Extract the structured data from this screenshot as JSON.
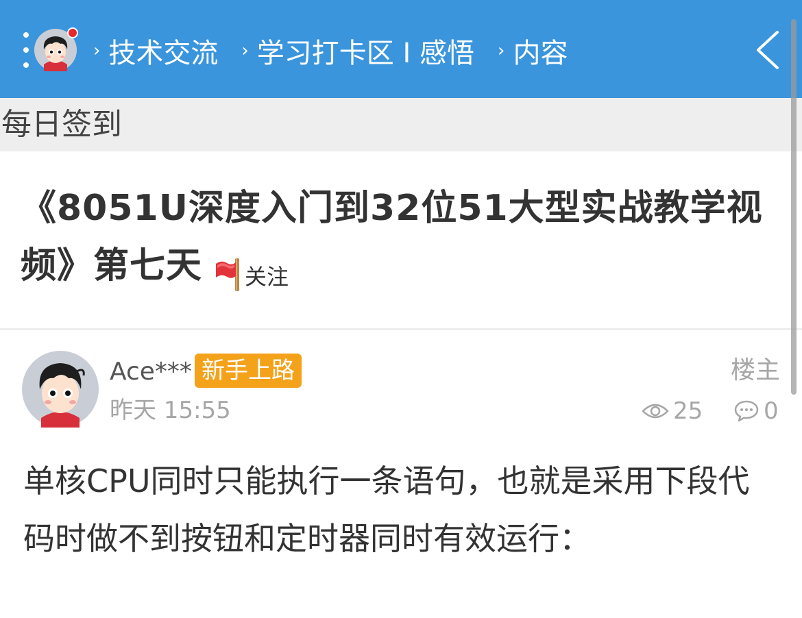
{
  "colors": {
    "accent": "#3a95dc",
    "badge": "#f5a21b",
    "notification": "#e8262b",
    "meta_text": "#a6a6a6"
  },
  "header": {
    "breadcrumb": [
      "技术交流",
      "学习打卡区 I 感悟",
      "内容"
    ],
    "separator": "›",
    "icons": [
      "menu-dots-icon",
      "avatar",
      "notification-dot",
      "back-chevron-icon"
    ]
  },
  "category": "每日签到",
  "post": {
    "title": "《8051U深度入门到32位51大型实战教学视频》第七天",
    "follow_label": "关注",
    "author": "Ace***",
    "rank": "新手上路",
    "time": "昨天 15:55",
    "floor": "楼主",
    "views": "25",
    "replies": "0",
    "body": "单核CPU同时只能执行一条语句，也就是采用下段代码时做不到按钮和定时器同时有效运行："
  }
}
